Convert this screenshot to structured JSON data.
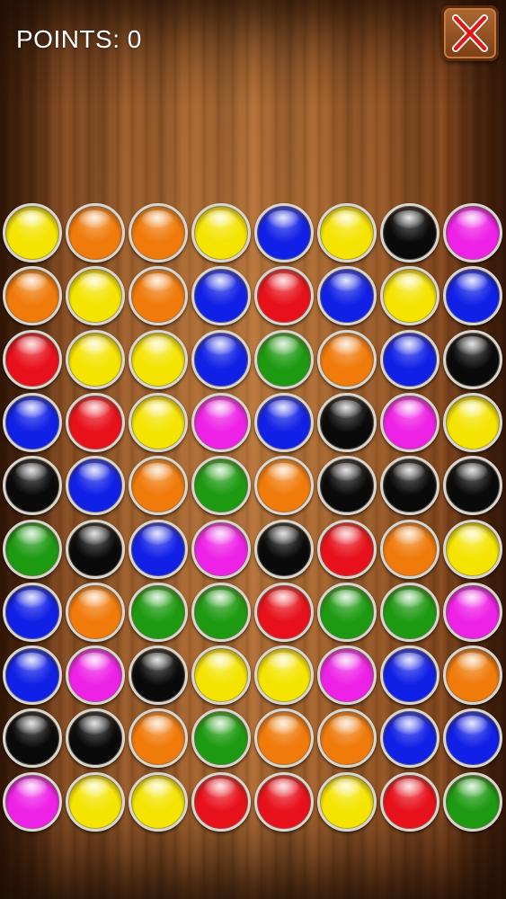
{
  "hud": {
    "score_label": "POINTS: 0"
  },
  "close_button": {
    "icon": "close-icon"
  },
  "palette": {
    "yellow": "#f4e400",
    "orange": "#f07a0a",
    "blue": "#1020e6",
    "red": "#e8101a",
    "green": "#1e9a12",
    "black": "#0a0a0a",
    "magenta": "#ee22e6"
  },
  "board": {
    "rows": [
      [
        "yellow",
        "orange",
        "orange",
        "yellow",
        "blue",
        "yellow",
        "black",
        "magenta"
      ],
      [
        "orange",
        "yellow",
        "orange",
        "blue",
        "red",
        "blue",
        "yellow",
        "blue"
      ],
      [
        "red",
        "yellow",
        "yellow",
        "blue",
        "green",
        "orange",
        "blue",
        "black"
      ],
      [
        "blue",
        "red",
        "yellow",
        "magenta",
        "blue",
        "black",
        "magenta",
        "yellow"
      ],
      [
        "black",
        "blue",
        "orange",
        "green",
        "orange",
        "black",
        "black",
        "black"
      ],
      [
        "green",
        "black",
        "blue",
        "magenta",
        "black",
        "red",
        "orange",
        "yellow"
      ],
      [
        "blue",
        "orange",
        "green",
        "green",
        "red",
        "green",
        "green",
        "magenta"
      ],
      [
        "blue",
        "magenta",
        "black",
        "yellow",
        "yellow",
        "magenta",
        "blue",
        "orange"
      ],
      [
        "black",
        "black",
        "orange",
        "green",
        "orange",
        "orange",
        "blue",
        "blue"
      ],
      [
        "magenta",
        "yellow",
        "yellow",
        "red",
        "red",
        "yellow",
        "red",
        "green"
      ]
    ]
  }
}
